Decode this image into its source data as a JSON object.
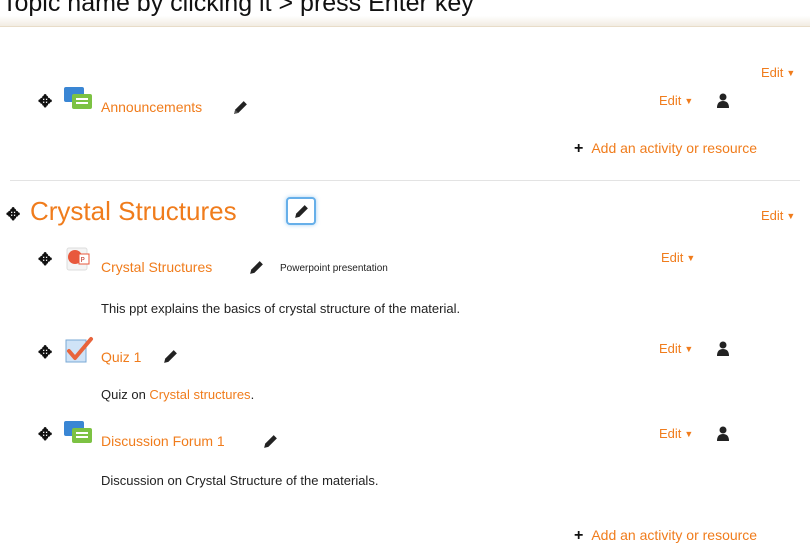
{
  "banner": {
    "text": "Topic name by clicking it > press Enter key"
  },
  "top_section": {
    "edit_label": "Edit",
    "activity": {
      "name": "Announcements",
      "edit_label": "Edit"
    },
    "add_activity_label": "Add an activity or resource"
  },
  "section": {
    "title": "Crystal Structures",
    "edit_label": "Edit",
    "activities": [
      {
        "name": "Crystal Structures",
        "type_label": "Powerpoint presentation",
        "description": "This ppt explains the basics of crystal structure of the material.",
        "edit_label": "Edit",
        "icon": "powerpoint-icon"
      },
      {
        "name": "Quiz 1",
        "description_prefix": "Quiz on ",
        "description_link": "Crystal structures",
        "description_suffix": ".",
        "edit_label": "Edit",
        "icon": "quiz-icon"
      },
      {
        "name": "Discussion Forum 1",
        "description": "Discussion on Crystal Structure of the materials.",
        "edit_label": "Edit",
        "icon": "forum-icon"
      }
    ],
    "add_activity_label": "Add an activity or resource"
  },
  "colors": {
    "link": "#f07c1c",
    "focus": "#66afe9"
  }
}
